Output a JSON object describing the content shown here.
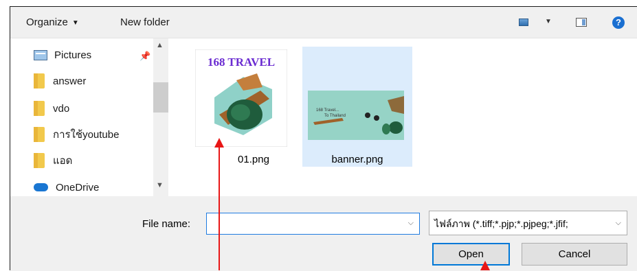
{
  "toolbar": {
    "organize_label": "Organize",
    "new_folder_label": "New folder",
    "view_icon": "view-icon",
    "preview_pane_icon": "preview-pane-icon",
    "help_icon": "help-icon",
    "help_glyph": "?"
  },
  "nav": {
    "items": [
      {
        "label": "Pictures",
        "icon": "pictures-icon"
      },
      {
        "label": "answer",
        "icon": "folder-icon"
      },
      {
        "label": "vdo",
        "icon": "folder-icon"
      },
      {
        "label": "การใช้youtube",
        "icon": "folder-icon"
      },
      {
        "label": "แอด",
        "icon": "folder-icon"
      },
      {
        "label": "OneDrive",
        "icon": "cloud-icon"
      }
    ]
  },
  "files": [
    {
      "name": "01.png",
      "thumb_title": "168 TRAVEL",
      "selected": false
    },
    {
      "name": "banner.png",
      "thumb_text_1": "168 Travel...",
      "thumb_text_2": "To Thailand",
      "selected": true
    }
  ],
  "bottom": {
    "file_name_label": "File name:",
    "file_name_value": "",
    "file_type_value": "ไฟล์ภาพ (*.tiff;*.pjp;*.pjpeg;*.jfif;",
    "open_label": "Open",
    "cancel_label": "Cancel"
  },
  "colors": {
    "accent": "#0078d7",
    "selected_bg": "#dcecfc",
    "annotation": "#e81616"
  }
}
